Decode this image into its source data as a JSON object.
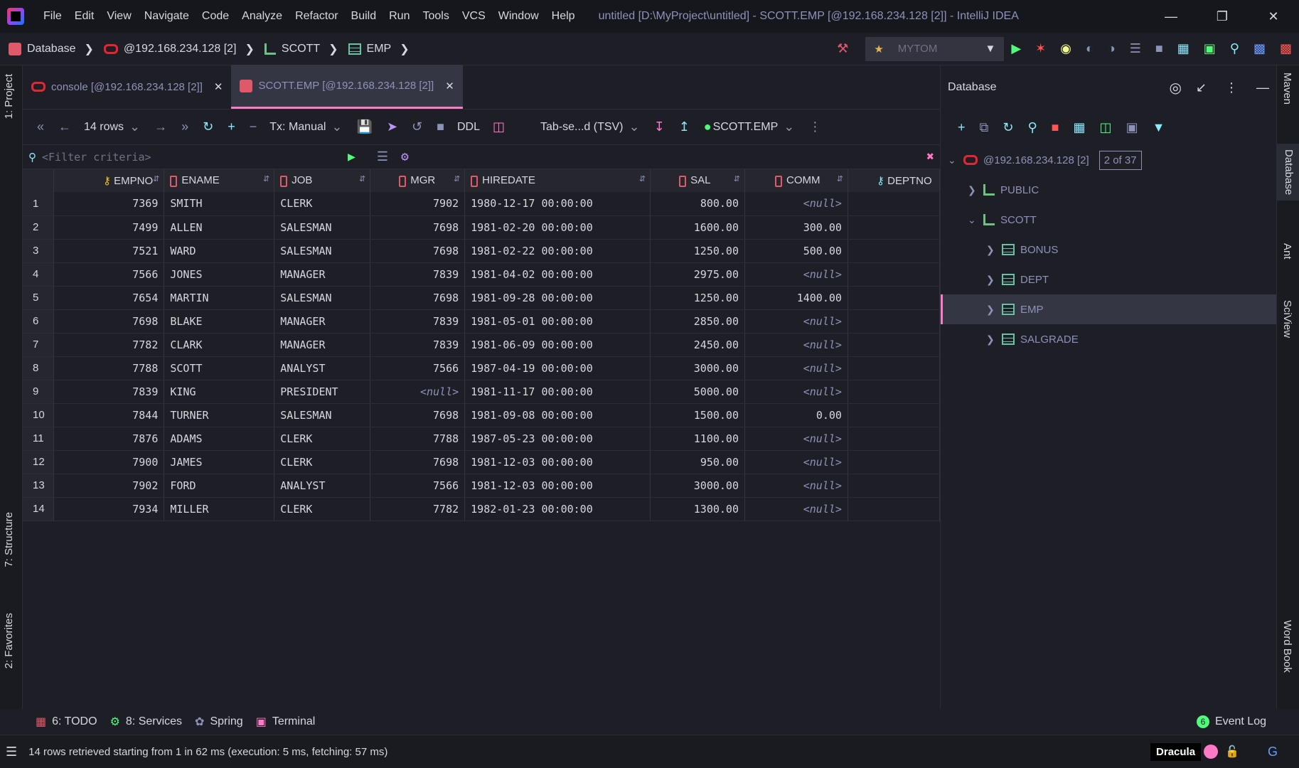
{
  "window": {
    "menu": [
      "File",
      "Edit",
      "View",
      "Navigate",
      "Code",
      "Analyze",
      "Refactor",
      "Build",
      "Run",
      "Tools",
      "VCS",
      "Window",
      "Help"
    ],
    "title": "untitled [D:\\MyProject\\untitled] - SCOTT.EMP [@192.168.234.128 [2]] - IntelliJ IDEA"
  },
  "breadcrumb": {
    "root": "Database",
    "connection": "@192.168.234.128 [2]",
    "schema": "SCOTT",
    "table": "EMP",
    "run_config": "MYTOM"
  },
  "tabs": [
    {
      "label": "console [@192.168.234.128 [2]]",
      "active": false
    },
    {
      "label": "SCOTT.EMP [@192.168.234.128 [2]]",
      "active": true
    }
  ],
  "grid_toolbar": {
    "rows": "14 rows",
    "tx": "Tx: Manual",
    "ddl": "DDL",
    "format": "Tab-se...d (TSV)",
    "target": "SCOTT.EMP"
  },
  "filter_placeholder": "<Filter criteria>",
  "columns": [
    "EMPNO",
    "ENAME",
    "JOB",
    "MGR",
    "HIREDATE",
    "SAL",
    "COMM",
    "DEPTNO"
  ],
  "rows": [
    [
      "7369",
      "SMITH",
      "CLERK",
      "7902",
      "1980-12-17 00:00:00",
      "800.00",
      "<null>"
    ],
    [
      "7499",
      "ALLEN",
      "SALESMAN",
      "7698",
      "1981-02-20 00:00:00",
      "1600.00",
      "300.00"
    ],
    [
      "7521",
      "WARD",
      "SALESMAN",
      "7698",
      "1981-02-22 00:00:00",
      "1250.00",
      "500.00"
    ],
    [
      "7566",
      "JONES",
      "MANAGER",
      "7839",
      "1981-04-02 00:00:00",
      "2975.00",
      "<null>"
    ],
    [
      "7654",
      "MARTIN",
      "SALESMAN",
      "7698",
      "1981-09-28 00:00:00",
      "1250.00",
      "1400.00"
    ],
    [
      "7698",
      "BLAKE",
      "MANAGER",
      "7839",
      "1981-05-01 00:00:00",
      "2850.00",
      "<null>"
    ],
    [
      "7782",
      "CLARK",
      "MANAGER",
      "7839",
      "1981-06-09 00:00:00",
      "2450.00",
      "<null>"
    ],
    [
      "7788",
      "SCOTT",
      "ANALYST",
      "7566",
      "1987-04-19 00:00:00",
      "3000.00",
      "<null>"
    ],
    [
      "7839",
      "KING",
      "PRESIDENT",
      "<null>",
      "1981-11-17 00:00:00",
      "5000.00",
      "<null>"
    ],
    [
      "7844",
      "TURNER",
      "SALESMAN",
      "7698",
      "1981-09-08 00:00:00",
      "1500.00",
      "0.00"
    ],
    [
      "7876",
      "ADAMS",
      "CLERK",
      "7788",
      "1987-05-23 00:00:00",
      "1100.00",
      "<null>"
    ],
    [
      "7900",
      "JAMES",
      "CLERK",
      "7698",
      "1981-12-03 00:00:00",
      "950.00",
      "<null>"
    ],
    [
      "7902",
      "FORD",
      "ANALYST",
      "7566",
      "1981-12-03 00:00:00",
      "3000.00",
      "<null>"
    ],
    [
      "7934",
      "MILLER",
      "CLERK",
      "7782",
      "1982-01-23 00:00:00",
      "1300.00",
      "<null>"
    ]
  ],
  "db_panel": {
    "title": "Database",
    "connection": "@192.168.234.128 [2]",
    "count": "2 of 37",
    "schemas": [
      "PUBLIC",
      "SCOTT"
    ],
    "tables": [
      "BONUS",
      "DEPT",
      "EMP",
      "SALGRADE"
    ]
  },
  "side_tabs": {
    "left": [
      "1: Project",
      "7: Structure",
      "2: Favorites"
    ],
    "right": [
      "Maven",
      "Database",
      "Ant",
      "SciView",
      "Word Book"
    ]
  },
  "bottom_tools": [
    "6: TODO",
    "8: Services",
    "Spring",
    "Terminal"
  ],
  "event_log": {
    "count": "6",
    "label": "Event Log"
  },
  "status": {
    "message": "14 rows retrieved starting from 1 in 62 ms (execution: 5 ms, fetching: 57 ms)",
    "theme": "Dracula"
  }
}
